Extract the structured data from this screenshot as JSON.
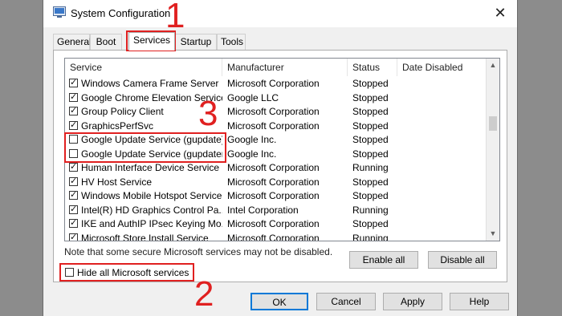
{
  "window": {
    "title": "System Configuration",
    "close_glyph": "✕"
  },
  "tabs": [
    "General",
    "Boot",
    "Services",
    "Startup",
    "Tools"
  ],
  "columns": [
    "Service",
    "Manufacturer",
    "Status",
    "Date Disabled"
  ],
  "rows": [
    {
      "checked": true,
      "service": "Windows Camera Frame Server",
      "manufacturer": "Microsoft Corporation",
      "status": "Stopped"
    },
    {
      "checked": true,
      "service": "Google Chrome Elevation Service",
      "manufacturer": "Google LLC",
      "status": "Stopped"
    },
    {
      "checked": true,
      "service": "Group Policy Client",
      "manufacturer": "Microsoft Corporation",
      "status": "Stopped"
    },
    {
      "checked": true,
      "service": "GraphicsPerfSvc",
      "manufacturer": "Microsoft Corporation",
      "status": "Stopped"
    },
    {
      "checked": false,
      "service": "Google Update Service (gupdate)",
      "manufacturer": "Google Inc.",
      "status": "Stopped"
    },
    {
      "checked": false,
      "service": "Google Update Service (gupdatem)",
      "manufacturer": "Google Inc.",
      "status": "Stopped"
    },
    {
      "checked": true,
      "service": "Human Interface Device Service",
      "manufacturer": "Microsoft Corporation",
      "status": "Running"
    },
    {
      "checked": true,
      "service": "HV Host Service",
      "manufacturer": "Microsoft Corporation",
      "status": "Stopped"
    },
    {
      "checked": true,
      "service": "Windows Mobile Hotspot Service",
      "manufacturer": "Microsoft Corporation",
      "status": "Stopped"
    },
    {
      "checked": true,
      "service": "Intel(R) HD Graphics Control Pa...",
      "manufacturer": "Intel Corporation",
      "status": "Running"
    },
    {
      "checked": true,
      "service": "IKE and AuthIP IPsec Keying Mo...",
      "manufacturer": "Microsoft Corporation",
      "status": "Stopped"
    },
    {
      "checked": true,
      "service": "Microsoft Store Install Service",
      "manufacturer": "Microsoft Corporation",
      "status": "Running"
    }
  ],
  "note": "Note that some secure Microsoft services may not be disabled.",
  "buttons": {
    "enable_all": "Enable all",
    "disable_all": "Disable all",
    "ok": "OK",
    "cancel": "Cancel",
    "apply": "Apply",
    "help": "Help"
  },
  "hide_ms_services": {
    "label": "Hide all Microsoft services",
    "checked": false
  },
  "annotations": {
    "one": "1",
    "two": "2",
    "three": "3"
  },
  "colors": {
    "annotation_red": "#e02020",
    "focus_blue": "#0078d7"
  }
}
